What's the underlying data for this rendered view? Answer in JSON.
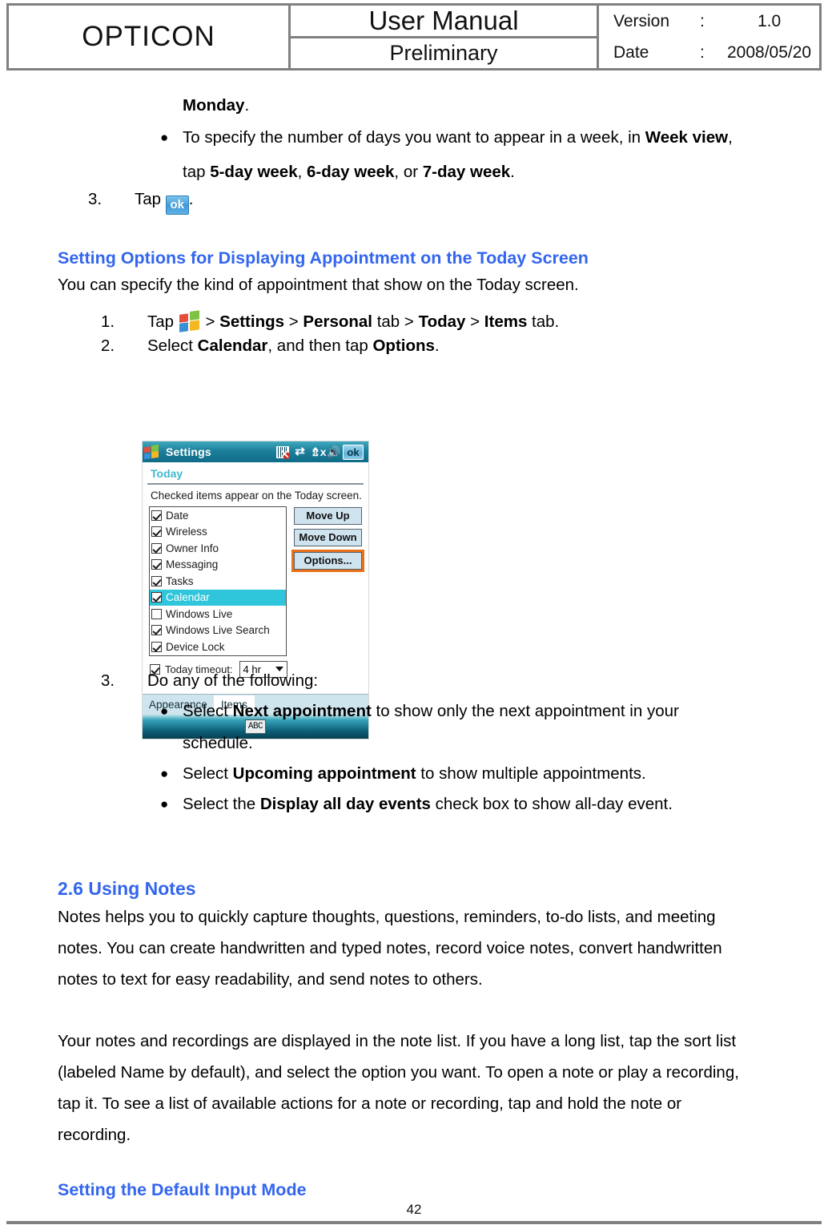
{
  "header": {
    "logo": "OPTICON",
    "title": "User Manual",
    "subtitle": "Preliminary",
    "version_label": "Version",
    "version_colon": ":",
    "version_value": "1.0",
    "date_label": "Date",
    "date_colon": ":",
    "date_value": "2008/05/20"
  },
  "content": {
    "monday_line": "Monday",
    "monday_period": ".",
    "bullet_week_pre": "To specify the number of days you want to appear in a week, in ",
    "bullet_week_bold": "Week view",
    "bullet_week_comma": ",",
    "bullet_week_line2_pre": "tap ",
    "bullet_week_b1": "5-day week",
    "bullet_week_sep1": ", ",
    "bullet_week_b2": "6-day week",
    "bullet_week_sep2": ", or ",
    "bullet_week_b3": "7-day week",
    "bullet_week_end": ".",
    "step3_num": "3.",
    "step3_tap": "Tap",
    "step3_ok": "ok",
    "step3_period": ".",
    "heading_today": "Setting Options for Displaying Appointment on the Today Screen",
    "intro_today": "You can specify the kind of appointment that show on the Today screen.",
    "s1_num": "1.",
    "s1_tap": "Tap",
    "s1_gt1": " > ",
    "s1_settings": "Settings",
    "s1_gt2": " > ",
    "s1_personal": "Personal",
    "s1_tab1": " tab > ",
    "s1_today": "Today",
    "s1_gt3": " > ",
    "s1_items": "Items",
    "s1_tab2": " tab.",
    "s2_num": "2.",
    "s2_pre": "Select ",
    "s2_calendar": "Calendar",
    "s2_mid": ", and then tap ",
    "s2_options": "Options",
    "s2_end": ".",
    "s3_num": "3.",
    "s3_text": "Do any of the following:",
    "b1_pre": "Select ",
    "b1_bold": "Next appointment",
    "b1_post": " to show only the next appointment in your",
    "b1_line2": "schedule.",
    "b2_pre": "Select ",
    "b2_bold": "Upcoming appointment",
    "b2_post": " to show multiple appointments.",
    "b3_pre": "Select the ",
    "b3_bold": "Display all day events",
    "b3_post": " check box to show all-day event.",
    "section_notes": "2.6 Using Notes",
    "notes_p1_l1": "Notes helps you to quickly capture thoughts, questions, reminders, to-do lists, and meeting",
    "notes_p1_l2": "notes. You can create handwritten and typed notes, record voice notes, convert handwritten",
    "notes_p1_l3": "notes to text for easy readability, and send notes to others.",
    "notes_p2_l1": "Your notes and recordings are displayed in the note list. If you have a long list, tap the sort list",
    "notes_p2_l2": "(labeled Name by default), and select the option you want. To open a note or play a recording,",
    "notes_p2_l3": "tap it. To see a list of available actions for a note or recording, tap and hold the note or",
    "notes_p2_l4": "recording.",
    "heading_input": "Setting the Default Input Mode"
  },
  "pda": {
    "app_title": "Settings",
    "ok_label": "ok",
    "page_title": "Today",
    "description": "Checked items appear on the Today screen.",
    "items": [
      {
        "label": "Date",
        "checked": true,
        "selected": false
      },
      {
        "label": "Wireless",
        "checked": true,
        "selected": false
      },
      {
        "label": "Owner Info",
        "checked": true,
        "selected": false
      },
      {
        "label": "Messaging",
        "checked": true,
        "selected": false
      },
      {
        "label": "Tasks",
        "checked": true,
        "selected": false
      },
      {
        "label": "Calendar",
        "checked": true,
        "selected": true
      },
      {
        "label": "Windows Live",
        "checked": false,
        "selected": false
      },
      {
        "label": "Windows Live Search",
        "checked": true,
        "selected": false
      },
      {
        "label": "Device Lock",
        "checked": true,
        "selected": false
      }
    ],
    "buttons": {
      "move_up": "Move Up",
      "move_down": "Move Down",
      "options": "Options..."
    },
    "timeout": {
      "checked": true,
      "label": "Today timeout:",
      "value": "4 hr"
    },
    "tabs": [
      {
        "label": "Appearance",
        "active": false
      },
      {
        "label": "Items",
        "active": true
      }
    ],
    "soft_input": "ABC",
    "colors": {
      "titlebar": "#1d7f9b",
      "selection": "#2FC5DA",
      "subtitle": "#3fb8cf",
      "focus_outline": "#E8701A",
      "button_face": "#cfe3ef"
    }
  },
  "footer": {
    "page_number": "42"
  },
  "theme": {
    "heading_blue": "#3366EE",
    "border_gray": "#808080"
  }
}
